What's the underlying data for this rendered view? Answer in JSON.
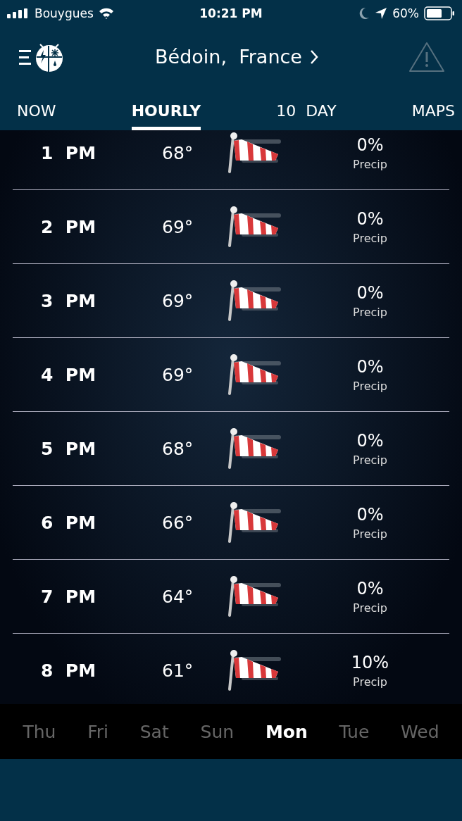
{
  "status_bar": {
    "carrier": "Bouygues",
    "time": "10:21 PM",
    "battery": "60%"
  },
  "header": {
    "location": "Bédoin,  France"
  },
  "tabs": [
    {
      "label": "NOW",
      "selected": false
    },
    {
      "label": "HOURLY",
      "selected": true
    },
    {
      "label": "10  DAY",
      "selected": false
    },
    {
      "label": "MAPS",
      "selected": false
    }
  ],
  "hours": [
    {
      "time": "1  PM",
      "temp": "68°",
      "precip": "0%",
      "precip_label": "Precip"
    },
    {
      "time": "2  PM",
      "temp": "69°",
      "precip": "0%",
      "precip_label": "Precip"
    },
    {
      "time": "3  PM",
      "temp": "69°",
      "precip": "0%",
      "precip_label": "Precip"
    },
    {
      "time": "4  PM",
      "temp": "69°",
      "precip": "0%",
      "precip_label": "Precip"
    },
    {
      "time": "5  PM",
      "temp": "68°",
      "precip": "0%",
      "precip_label": "Precip"
    },
    {
      "time": "6  PM",
      "temp": "66°",
      "precip": "0%",
      "precip_label": "Precip"
    },
    {
      "time": "7  PM",
      "temp": "64°",
      "precip": "0%",
      "precip_label": "Precip"
    },
    {
      "time": "8  PM",
      "temp": "61°",
      "precip": "10%",
      "precip_label": "Precip"
    }
  ],
  "days": [
    {
      "label": "Thu",
      "selected": false
    },
    {
      "label": "Fri",
      "selected": false
    },
    {
      "label": "Sat",
      "selected": false
    },
    {
      "label": "Sun",
      "selected": false
    },
    {
      "label": "Mon",
      "selected": true
    },
    {
      "label": "Tue",
      "selected": false
    },
    {
      "label": "Wed",
      "selected": false
    }
  ]
}
